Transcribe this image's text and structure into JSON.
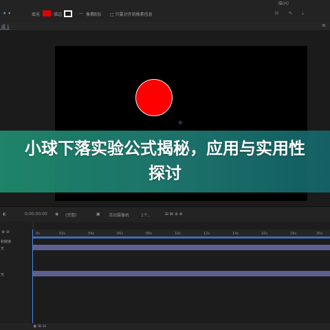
{
  "menu": {
    "title_fragment": "描(H)"
  },
  "toolbar": {
    "fill_label": "填充",
    "fill_color": "#e00000",
    "stroke_label": "描边",
    "stroke_color": "#ffffff",
    "pixels_label": "像素",
    "add_label": "添加",
    "snap_label": "□ 只要对齐到像素信息"
  },
  "comp": {
    "tab_label": "成 1",
    "canvas_color": "#000000",
    "ball_color": "#ff0000"
  },
  "banner": {
    "title": "小球下落实验公式揭秘，应用与实用性探讨"
  },
  "timeline": {
    "timecode": "0:00:00:00",
    "quality": "(完整)",
    "camera": "活动摄像机",
    "views": "1个..",
    "ruler_ticks": [
      "0s",
      "02s",
      "04s",
      "06s",
      "08s",
      "10s",
      "12s",
      "14s",
      "16s",
      "18s",
      "20s"
    ],
    "left_label_1": "和链接",
    "left_label_2": "无",
    "left_label_3": "无",
    "track_color": "#5d5f8f"
  }
}
